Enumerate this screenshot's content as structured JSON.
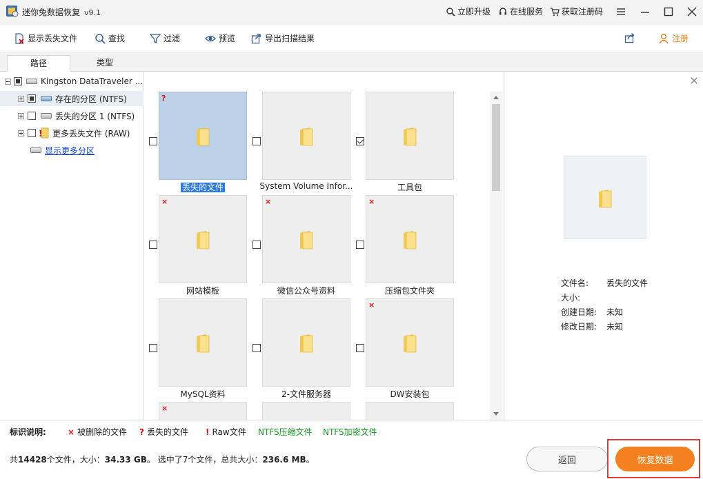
{
  "app": {
    "title": "迷你兔数据恢复",
    "version": "v9.1",
    "links": {
      "upgrade": "立即升级",
      "service": "在线服务",
      "regcode": "获取注册码"
    }
  },
  "toolbar": {
    "show_lost": "显示丢失文件",
    "find": "查找",
    "filter": "过滤",
    "preview": "预览",
    "export": "导出扫描结果",
    "register": "注册"
  },
  "tabs": [
    "路径",
    "类型"
  ],
  "tree": {
    "root": "Kingston DataTraveler ...",
    "items": [
      {
        "label": "存在的分区 (NTFS)"
      },
      {
        "label": "丢失的分区 1 (NTFS)"
      },
      {
        "label": "更多丢失文件 (RAW)"
      }
    ],
    "more": "显示更多分区"
  },
  "files": [
    {
      "name": "丢失的文件",
      "mark": "?",
      "checked": false,
      "selected": true
    },
    {
      "name": "System Volume Infor...",
      "mark": "",
      "checked": false,
      "selected": false
    },
    {
      "name": "工具包",
      "mark": "",
      "checked": true,
      "selected": false
    },
    {
      "name": "网站模板",
      "mark": "×",
      "checked": false,
      "selected": false
    },
    {
      "name": "微信公众号资料",
      "mark": "×",
      "checked": false,
      "selected": false
    },
    {
      "name": "压缩包文件夹",
      "mark": "×",
      "checked": false,
      "selected": false
    },
    {
      "name": "MySQL资料",
      "mark": "",
      "checked": false,
      "selected": false
    },
    {
      "name": "2-文件服务器",
      "mark": "",
      "checked": false,
      "selected": false
    },
    {
      "name": "DW安装包",
      "mark": "×",
      "checked": false,
      "selected": false
    },
    {
      "name": "",
      "mark": "×",
      "checked": false,
      "selected": false
    },
    {
      "name": "",
      "mark": "",
      "checked": false,
      "selected": false
    },
    {
      "name": "",
      "mark": "",
      "checked": false,
      "selected": false
    }
  ],
  "preview": {
    "filename_label": "文件名:",
    "filename": "丢失的文件",
    "size_label": "大小:",
    "size": "",
    "created_label": "创建日期:",
    "created": "未知",
    "modified_label": "修改日期:",
    "modified": "未知"
  },
  "legend": {
    "title": "标识说明:",
    "deleted": "被删除的文件",
    "lost": "丢失的文件",
    "raw": "Raw文件",
    "ntfs_comp": "NTFS压缩文件",
    "ntfs_enc": "NTFS加密文件"
  },
  "status": {
    "prefix": "共",
    "count": "14428",
    "mid1": "个文件，大小：",
    "size": "34.33 GB",
    "mid2": "。 选中了7个文件，总共大小：",
    "selsize": "236.6 MB",
    "suffix": "。"
  },
  "buttons": {
    "back": "返回",
    "recover": "恢复数据"
  },
  "colors": {
    "accent": "#f4801f",
    "highlight": "#e23a3a",
    "green": "#1a9a25",
    "mark_red": "#d11111"
  }
}
